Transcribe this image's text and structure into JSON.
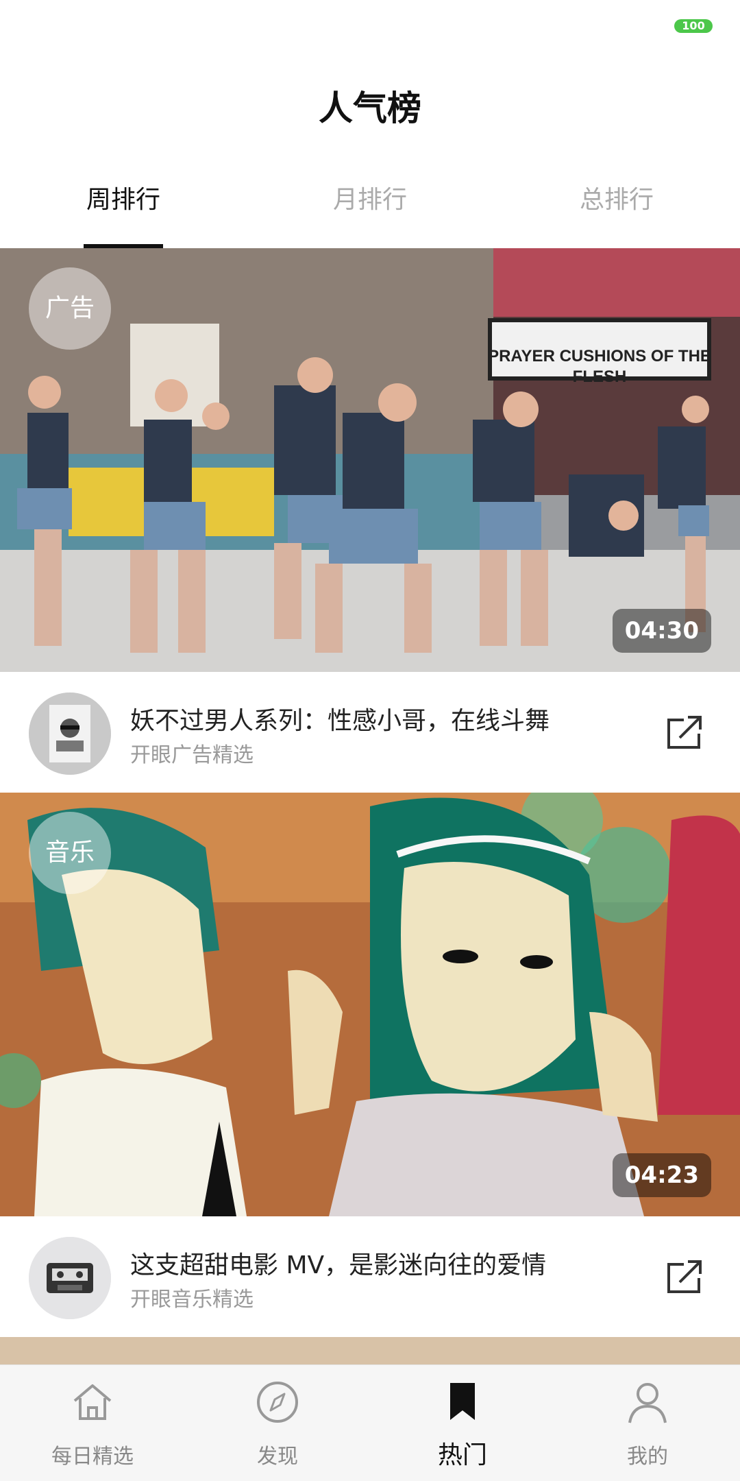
{
  "status_bar": {
    "battery": "100"
  },
  "header": {
    "title": "人气榜"
  },
  "tabs": [
    {
      "label": "周排行",
      "active": true
    },
    {
      "label": "月排行",
      "active": false
    },
    {
      "label": "总排行",
      "active": false
    }
  ],
  "cards": [
    {
      "tag": "广告",
      "duration": "04:30",
      "title": "妖不过男人系列：性感小哥，在线斗舞",
      "subtitle": "开眼广告精选",
      "image": "street-dancers-photo",
      "avatar": "man-portrait-icon"
    },
    {
      "tag": "音乐",
      "duration": "04:23",
      "title": "这支超甜电影 MV，是影迷向往的爱情",
      "subtitle": "开眼音乐精选",
      "image": "illustrated-couple-artwork",
      "avatar": "cassette-tape-icon"
    }
  ],
  "bottom_nav": [
    {
      "label": "每日精选",
      "icon": "home-icon",
      "active": false
    },
    {
      "label": "发现",
      "icon": "compass-icon",
      "active": false
    },
    {
      "label": "热门",
      "icon": "bookmark-icon",
      "active": true
    },
    {
      "label": "我的",
      "icon": "user-icon",
      "active": false
    }
  ],
  "colors": {
    "accent": "#111111",
    "battery": "#4cc74a",
    "inactive": "#aaaaaa"
  }
}
